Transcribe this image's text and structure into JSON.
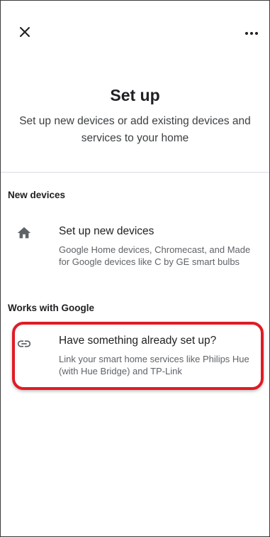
{
  "header": {
    "title": "Set up",
    "subtitle": "Set up new devices or add existing devices and services to your home"
  },
  "sections": {
    "new_devices": {
      "heading": "New devices",
      "item": {
        "icon": "home-icon",
        "title": "Set up new devices",
        "description": "Google Home devices, Chromecast, and Made for Google devices like C by GE smart bulbs"
      }
    },
    "works_with_google": {
      "heading": "Works with Google",
      "item": {
        "icon": "link-icon",
        "title": "Have something already set up?",
        "description": "Link your smart home services like Philips Hue (with Hue Bridge) and TP-Link"
      }
    }
  },
  "icons": {
    "close": "close-icon",
    "more": "more-horizontal-icon"
  },
  "colors": {
    "highlight": "#e01b24",
    "icon": "#5f6368",
    "divider": "#dadce0"
  }
}
